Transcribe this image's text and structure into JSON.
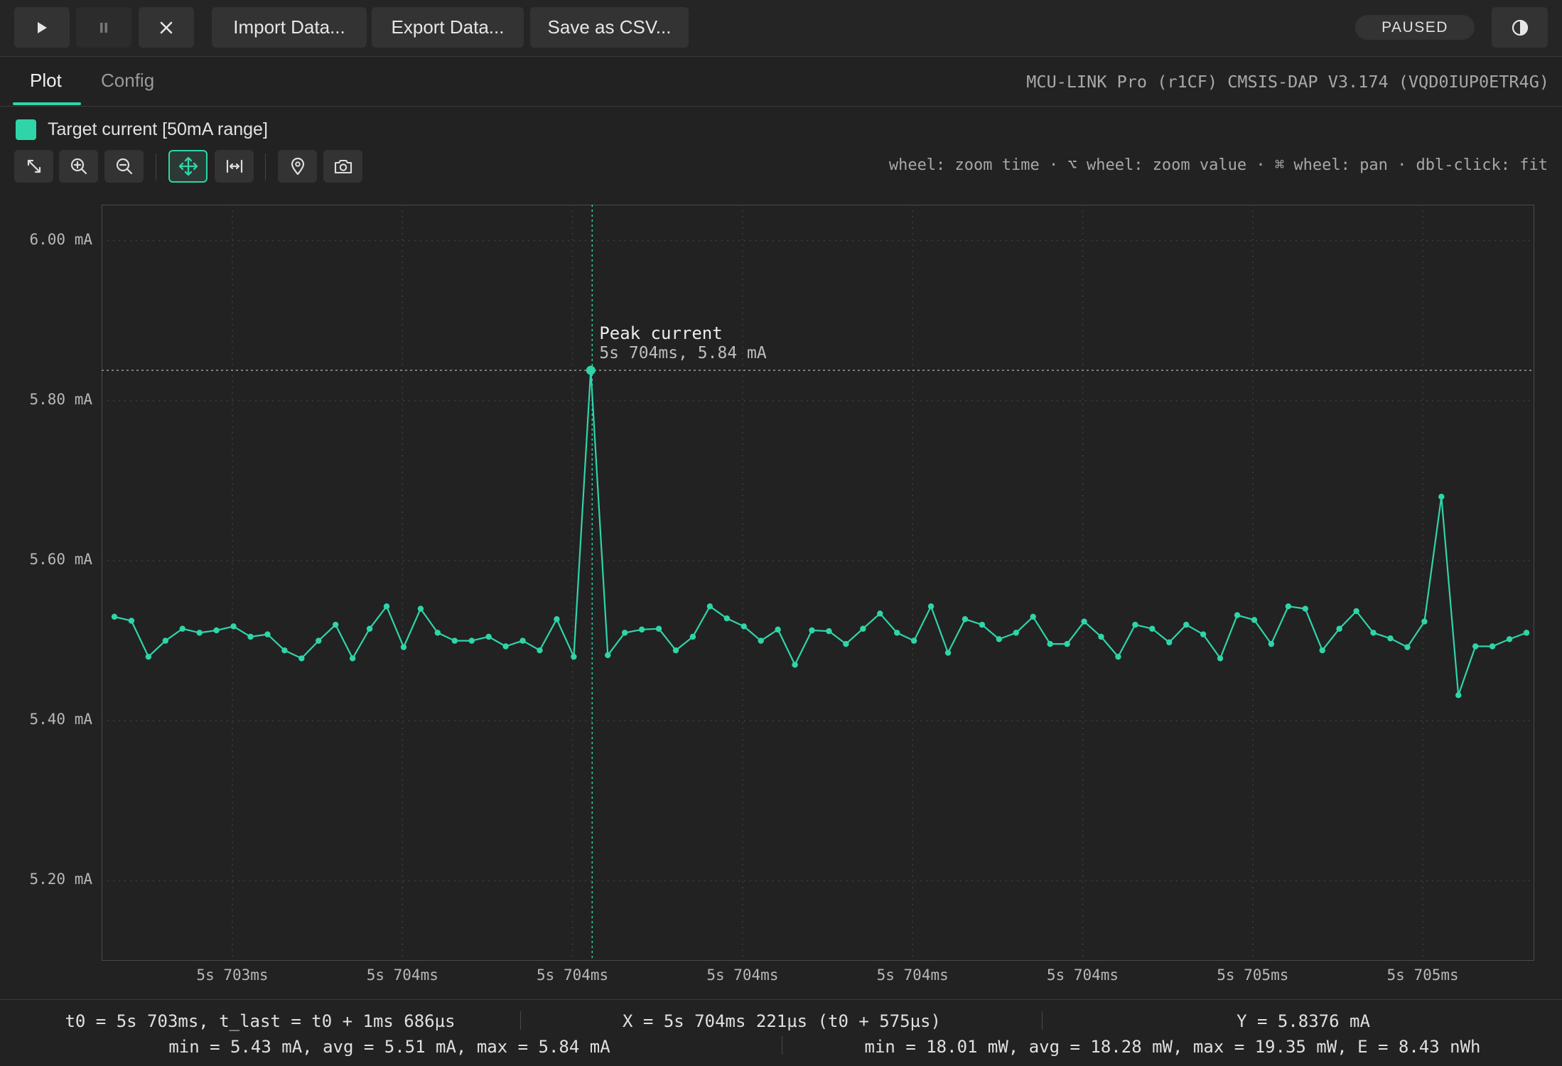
{
  "toolbar": {
    "play_icon": "play-icon",
    "pause_icon": "pause-icon",
    "close_icon": "close-icon",
    "import_label": "Import Data...",
    "export_label": "Export Data...",
    "save_csv_label": "Save as CSV...",
    "status": "PAUSED",
    "theme_icon": "contrast-icon"
  },
  "tabs": [
    {
      "label": "Plot",
      "active": true
    },
    {
      "label": "Config",
      "active": false
    }
  ],
  "device": "MCU-LINK Pro (r1CF) CMSIS-DAP V3.174 (VQD0IUP0ETR4G)",
  "legend": {
    "label": "Target current [50mA range]",
    "color": "#2fd5a8"
  },
  "plot_tools": [
    "fit-icon",
    "zoom-in-icon",
    "zoom-out-icon",
    "pan-icon",
    "measure-span-icon",
    "marker-icon",
    "camera-icon"
  ],
  "hints": "wheel: zoom time · ⌥ wheel: zoom value · ⌘ wheel: pan · dbl-click: fit",
  "chart_data": {
    "type": "line",
    "series": [
      {
        "name": "Target current [50mA range]",
        "color": "#2fd5a8",
        "values": [
          5.53,
          5.525,
          5.48,
          5.5,
          5.515,
          5.51,
          5.513,
          5.518,
          5.505,
          5.508,
          5.488,
          5.478,
          5.5,
          5.52,
          5.478,
          5.515,
          5.543,
          5.492,
          5.54,
          5.51,
          5.5,
          5.5,
          5.505,
          5.493,
          5.5,
          5.488,
          5.527,
          5.48,
          5.838,
          5.482,
          5.51,
          5.514,
          5.515,
          5.488,
          5.505,
          5.543,
          5.528,
          5.518,
          5.5,
          5.514,
          5.47,
          5.513,
          5.512,
          5.496,
          5.515,
          5.534,
          5.51,
          5.5,
          5.543,
          5.485,
          5.527,
          5.52,
          5.502,
          5.51,
          5.53,
          5.496,
          5.496,
          5.524,
          5.505,
          5.48,
          5.52,
          5.515,
          5.498,
          5.52,
          5.508,
          5.478,
          5.532,
          5.526,
          5.496,
          5.543,
          5.54,
          5.488,
          5.515,
          5.537,
          5.51,
          5.503,
          5.492,
          5.524,
          5.68,
          5.432,
          5.493,
          5.493,
          5.502,
          5.51
        ]
      }
    ],
    "y_ticks": [
      "6.00 mA",
      "5.80 mA",
      "5.60 mA",
      "5.40 mA",
      "5.20 mA"
    ],
    "y_tick_values": [
      6.0,
      5.8,
      5.6,
      5.4,
      5.2
    ],
    "ylim": [
      5.1,
      6.045
    ],
    "x_ticks": [
      "5s 703ms",
      "5s 704ms",
      "5s 704ms",
      "5s 704ms",
      "5s 704ms",
      "5s 704ms",
      "5s 705ms",
      "5s 705ms"
    ],
    "grid": true,
    "peak": {
      "title": "Peak current",
      "detail": "5s 704ms, 5.84 mA",
      "index": 28,
      "value": 5.838
    }
  },
  "footer": {
    "t_range": "t0 = 5s 703ms, t_last = t0 + 1ms 686µs",
    "x_readout": "X = 5s 704ms 221µs (t0 + 575µs)",
    "y_readout": "Y = 5.8376 mA",
    "current_stats": "min = 5.43 mA, avg = 5.51 mA, max = 5.84 mA",
    "power_stats": "min = 18.01 mW, avg = 18.28 mW, max = 19.35 mW, E = 8.43 nWh"
  }
}
